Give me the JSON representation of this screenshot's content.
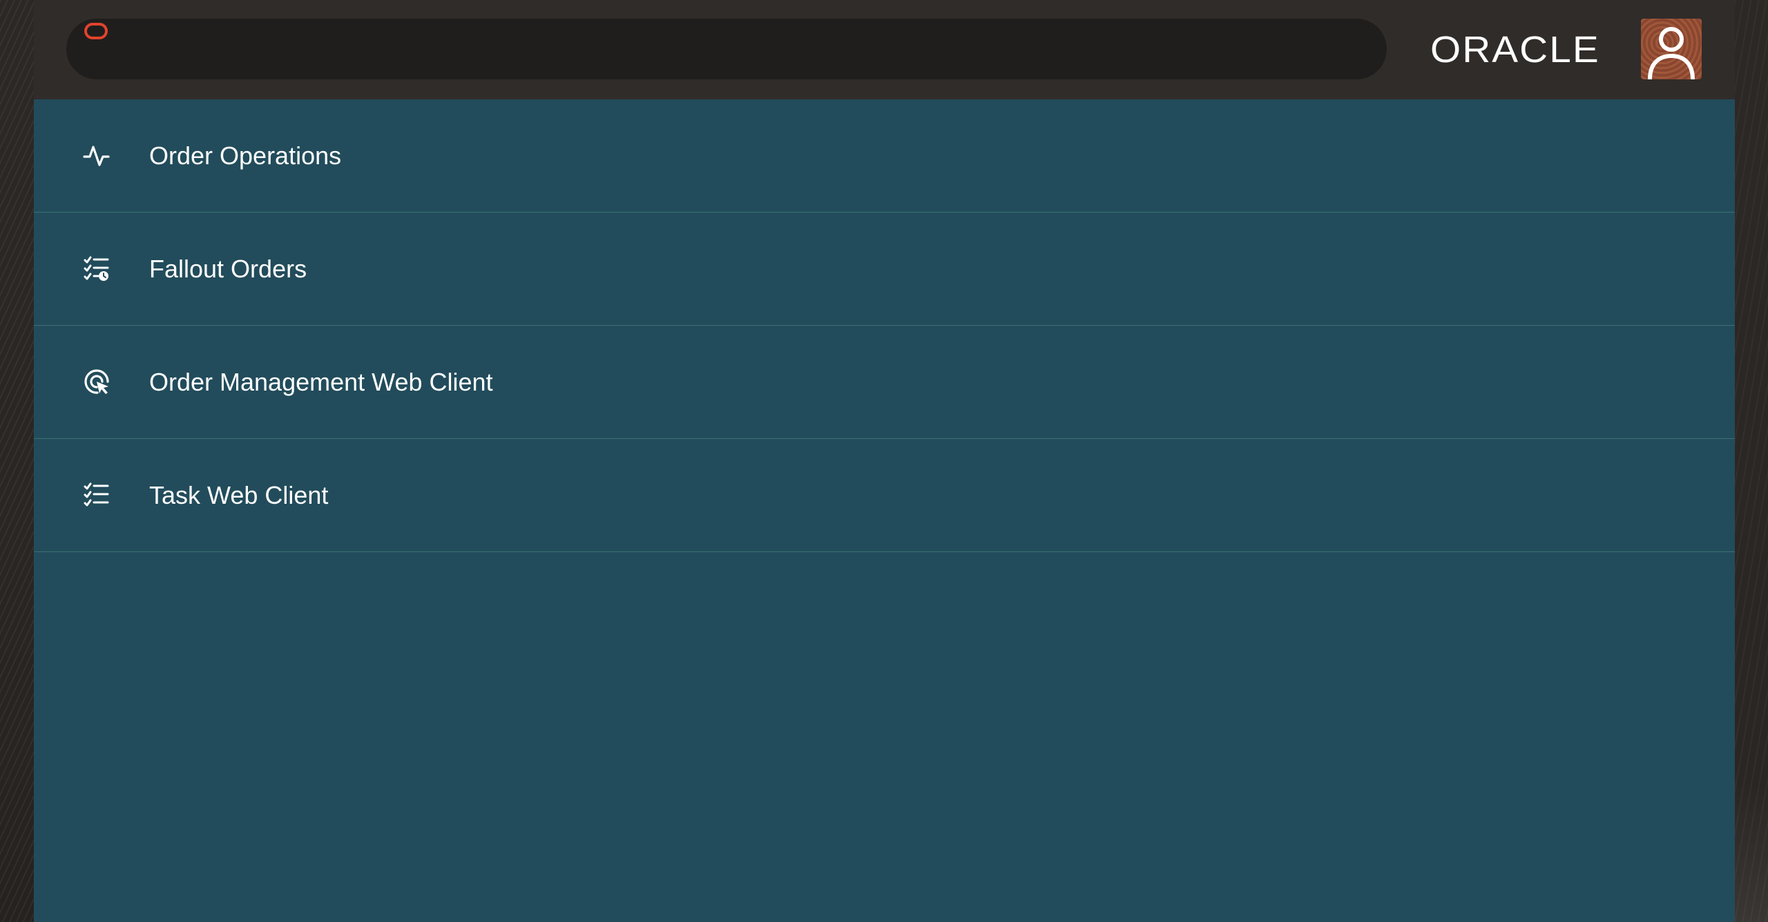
{
  "header": {
    "search_value": "",
    "brand_label": "ORACLE",
    "brand_color": "#e0432e",
    "header_bg": "#302c29"
  },
  "user": {
    "avatar_icon": "user-icon"
  },
  "menu": {
    "items": [
      {
        "label": "Order Operations",
        "icon": "activity-icon"
      },
      {
        "label": "Fallout Orders",
        "icon": "checklist-clock-icon"
      },
      {
        "label": "Order Management Web Client",
        "icon": "pointer-target-icon"
      },
      {
        "label": "Task Web Client",
        "icon": "checklist-icon"
      }
    ]
  },
  "colors": {
    "panel_bg": "#224c5b",
    "divider": "#3c6f74",
    "text": "#ffffff"
  }
}
